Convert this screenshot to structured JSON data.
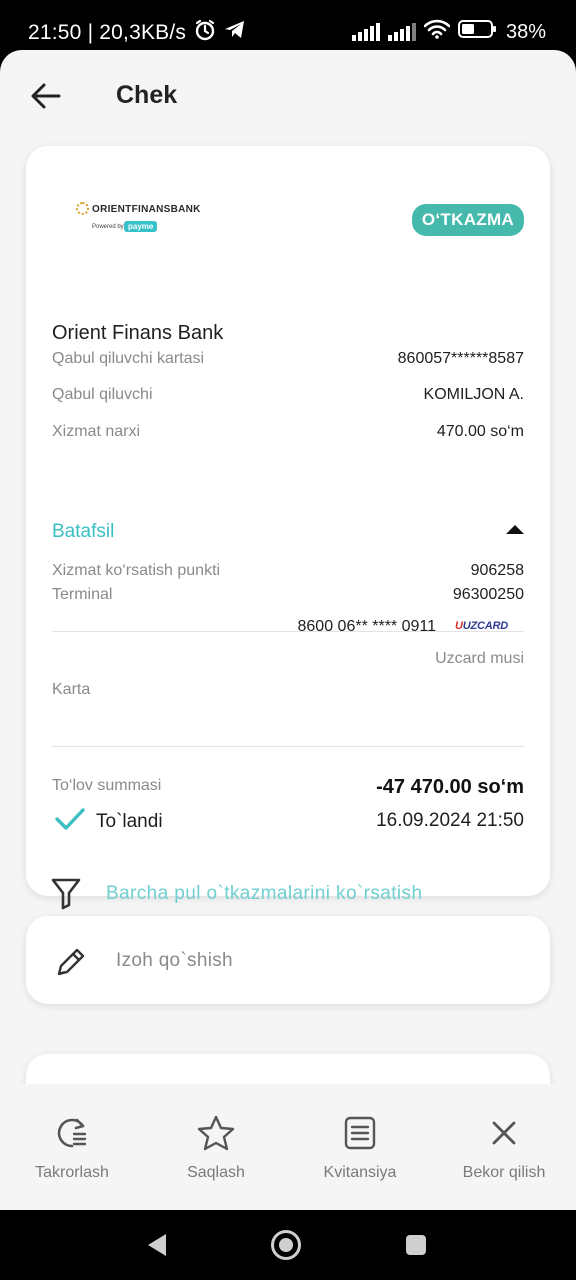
{
  "status_bar": {
    "time_speed": "21:50 | 20,3KB/s",
    "battery": "38%",
    "icons": [
      "alarm-icon",
      "telegram-icon",
      "signal-icon",
      "signal-icon",
      "wifi-icon",
      "battery-icon"
    ]
  },
  "header": {
    "title": "Chek"
  },
  "receipt": {
    "logo": {
      "bank": "ORIENTFINANSBANK",
      "powered_by": "Powered by",
      "brand": "payme"
    },
    "type_badge": "O‘TKAZMA",
    "bank_name": "Orient Finans Bank",
    "rows": [
      {
        "label": "Qabul qiluvchi kartasi",
        "value": "860057******8587"
      },
      {
        "label": "Qabul qiluvchi",
        "value": "KOMILJON A."
      },
      {
        "label": "Xizmat narxi",
        "value": "470.00 so‘m"
      }
    ],
    "details_label": "Batafsil",
    "details": [
      {
        "label": "Xizmat ko‘rsatish punkti",
        "value": "906258"
      },
      {
        "label": "Terminal",
        "value": "96300250"
      }
    ],
    "card": {
      "label": "Karta",
      "number": "8600 06** **** 0911",
      "brand_logo": "UZCARD",
      "name": "Uzcard musi"
    },
    "payment": {
      "amount_label": "To‘lov summasi",
      "amount": "-47 470.00 so‘m",
      "status": "To`landi",
      "datetime": "16.09.2024 21:50"
    },
    "show_all_link": "Barcha pul o`tkazmalarini ko`rsatish"
  },
  "note": {
    "label": "Izoh qo`shish"
  },
  "actions": [
    {
      "label": "Takrorlash",
      "icon": "repeat-icon"
    },
    {
      "label": "Saqlash",
      "icon": "star-icon"
    },
    {
      "label": "Kvitansiya",
      "icon": "receipt-icon"
    },
    {
      "label": "Bekor qilish",
      "icon": "close-icon"
    }
  ],
  "colors": {
    "accent": "#3bbfc2",
    "badge": "#45b9ab",
    "background": "#f5f5f5"
  }
}
